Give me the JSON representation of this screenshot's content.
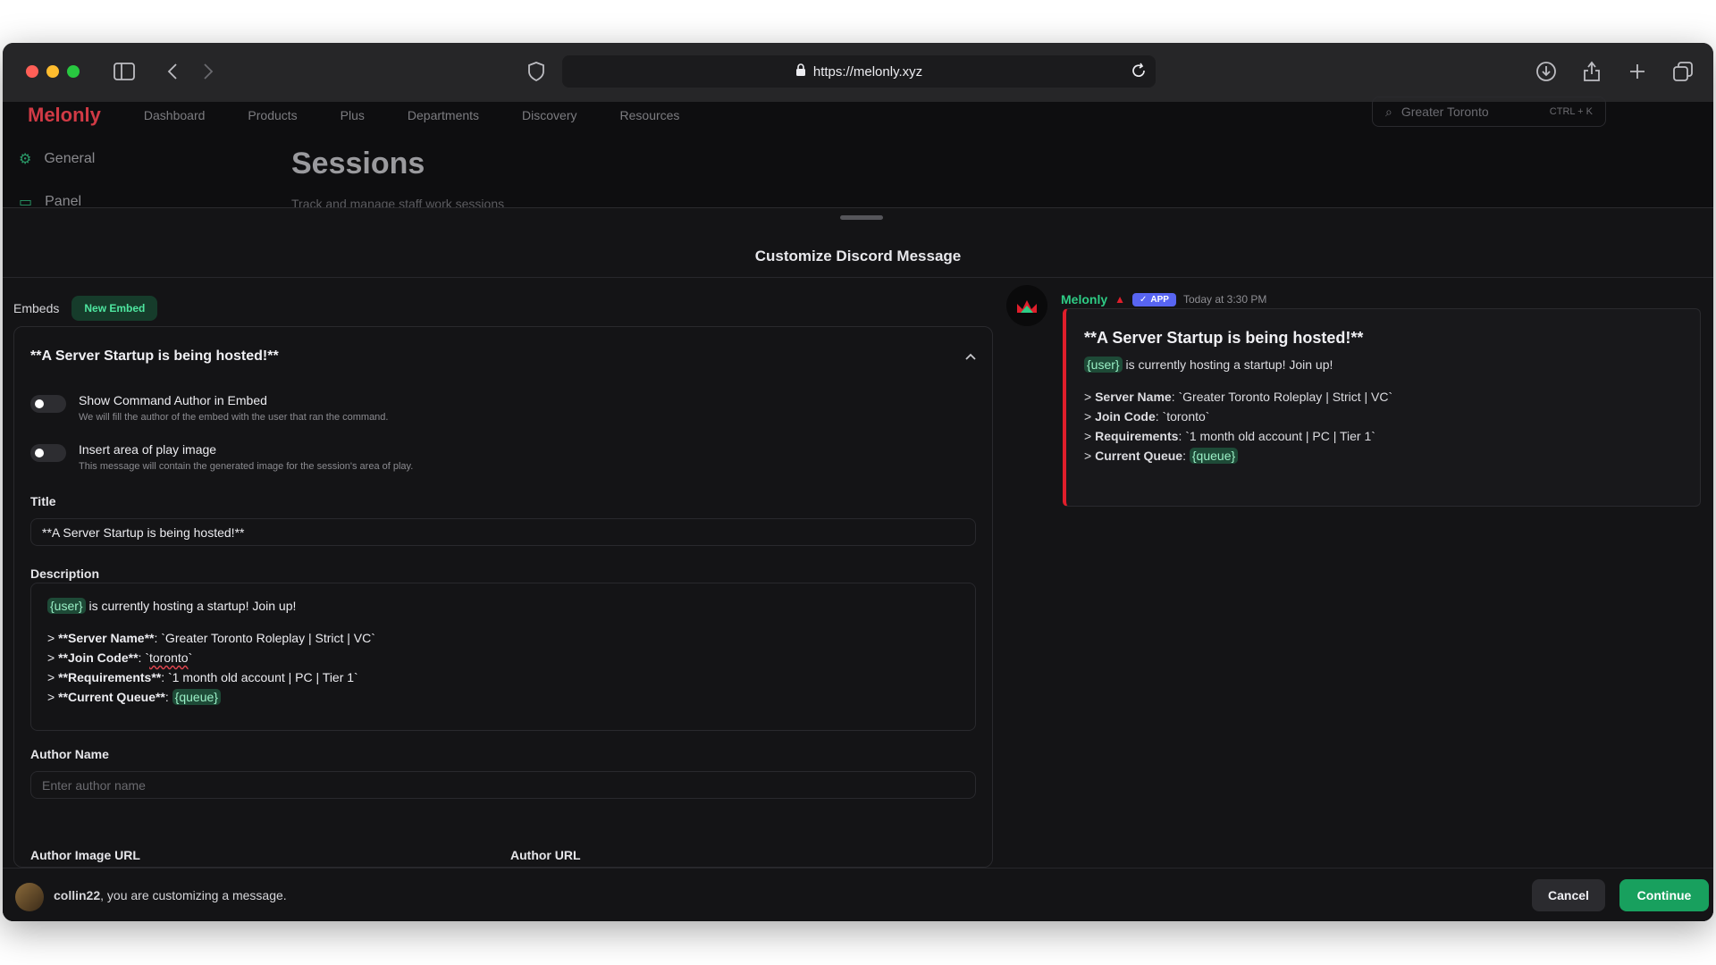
{
  "browser": {
    "url": "https://melonly.xyz"
  },
  "background_page": {
    "logo": "Melonly",
    "nav": [
      "Dashboard",
      "Products",
      "Plus",
      "Departments",
      "Discovery",
      "Resources"
    ],
    "search_placeholder": "Greater Toronto",
    "search_shortcut": "CTRL + K",
    "sidebar": [
      "General",
      "Panel"
    ],
    "title": "Sessions",
    "subtitle": "Track and manage staff work sessions"
  },
  "modal": {
    "title": "Customize Discord Message",
    "embeds_label": "Embeds",
    "new_embed_button": "New Embed"
  },
  "editor": {
    "header": "**A Server Startup is being hosted!**",
    "toggles": [
      {
        "label": "Show Command Author in Embed",
        "desc": "We will fill the author of the embed with the user that ran the command."
      },
      {
        "label": "Insert area of play image",
        "desc": "This message will contain the generated image for the session's area of play."
      }
    ],
    "title_label": "Title",
    "title_value": "**A Server Startup is being hosted!**",
    "description_label": "Description",
    "description": {
      "tag_user": "{user}",
      "line1": " is currently hosting a startup! Join up!",
      "l_server_prefix": "> ",
      "l_server_key": "**Server Name**",
      "l_server_val": ": `Greater Toronto Roleplay | Strict | VC`",
      "l_join_key": "**Join Code**",
      "l_join_sep": ": `",
      "l_join_code": "toronto",
      "l_join_end": "`",
      "l_req_key": "**Requirements**",
      "l_req_val": ": `1 month old account | PC | Tier 1`",
      "l_queue_key": "**Current Queue**",
      "l_queue_sep": ": ",
      "tag_queue": "{queue}"
    },
    "author_name_label": "Author Name",
    "author_name_placeholder": "Enter author name",
    "author_image_label": "Author Image URL",
    "author_url_label": "Author URL"
  },
  "preview": {
    "bot_name": "Melonly",
    "app_badge": "APP",
    "timestamp": "Today at 3:30 PM",
    "embed_title": "**A Server Startup is being hosted!**",
    "tag_user": "{user}",
    "line1": " is currently hosting a startup! Join up!",
    "server_key": "Server Name",
    "server_val": ": `Greater Toronto Roleplay | Strict | VC`",
    "join_key": "Join Code",
    "join_val": ": `toronto`",
    "req_key": "Requirements",
    "req_val": ": `1 month old account | PC | Tier 1`",
    "queue_key": "Current Queue",
    "queue_sep": ": ",
    "tag_queue": "{queue}"
  },
  "footer": {
    "username": "collin22",
    "message": ", you are customizing a message.",
    "cancel": "Cancel",
    "continue": "Continue"
  },
  "colors": {
    "accent_green": "#18a05e",
    "embed_border_red": "#e01e2b",
    "app_badge": "#5865f2"
  }
}
